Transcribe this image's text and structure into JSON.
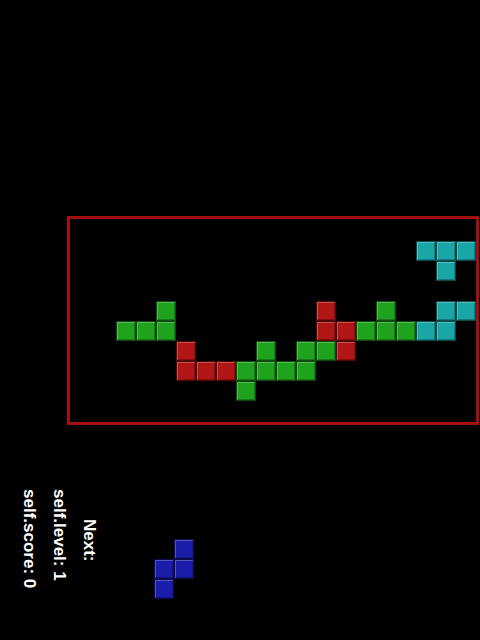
{
  "board": {
    "rows": [
      "....................",
      ".................CCC",
      "..................C.",
      "....................",
      "....G.......R..G..CC",
      "..GGG.......RRGGGCC.",
      ".....R...G.GGR......",
      ".....RRRGGGG........",
      "........G...........",
      "...................."
    ]
  },
  "colors": {
    "C": "#1aa6a6",
    "G": "#1fa31f",
    "R": "#b01616",
    "B": "#1c1caa"
  },
  "hud": {
    "score": "self.score: 0",
    "level": "self.level: 1",
    "next_label": "Next:"
  },
  "next_piece": {
    "rows": [
      ".B",
      "BB",
      "B."
    ]
  }
}
